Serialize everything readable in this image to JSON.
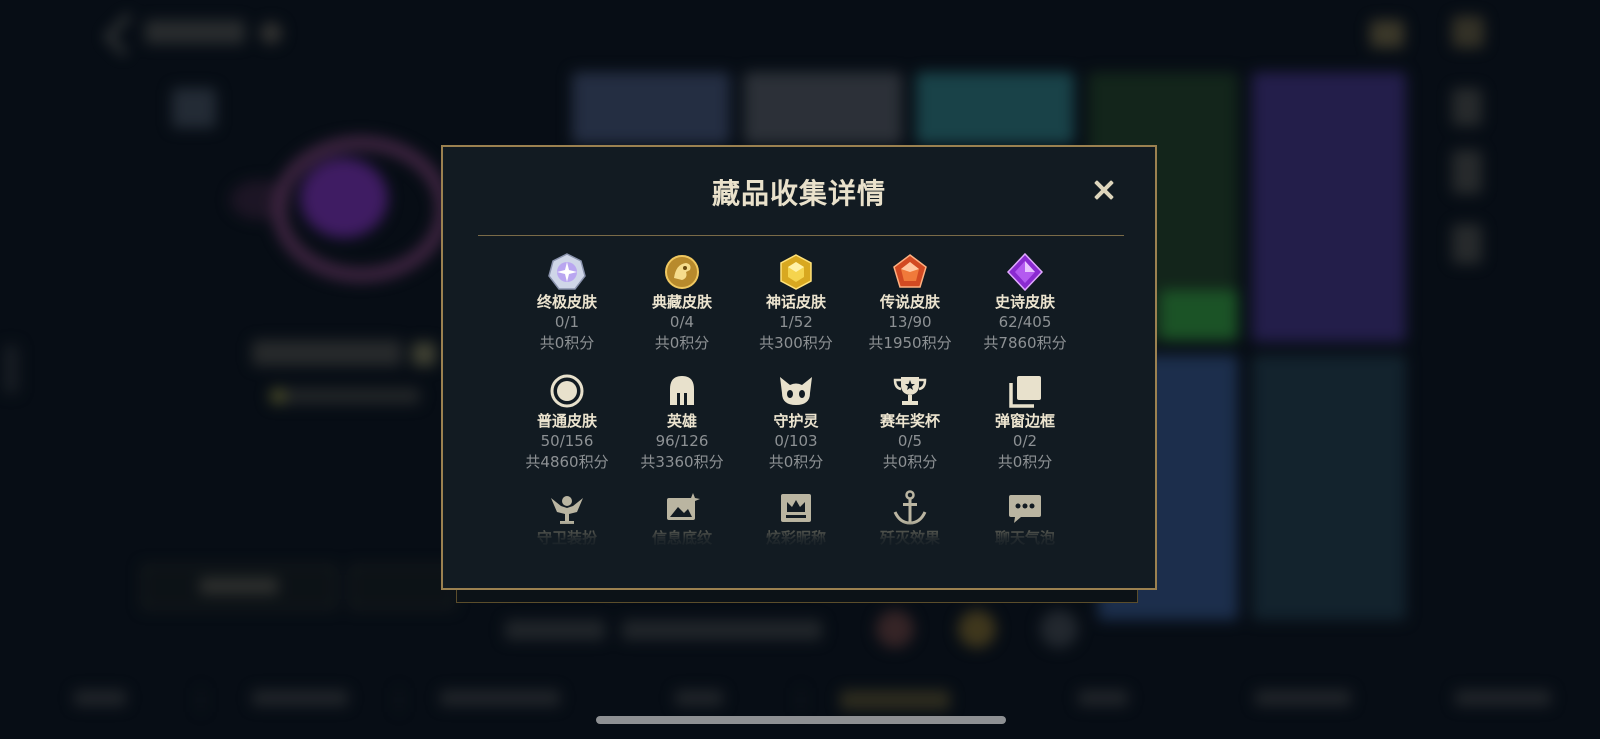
{
  "modal": {
    "title": "藏品收集详情",
    "close_label": "✕"
  },
  "rows": [
    [
      {
        "icon": "ultimate-skin-icon",
        "name": "终极皮肤",
        "count": "0/1",
        "points": "共0积分"
      },
      {
        "icon": "prestige-skin-icon",
        "name": "典藏皮肤",
        "count": "0/4",
        "points": "共0积分"
      },
      {
        "icon": "mythic-skin-icon",
        "name": "神话皮肤",
        "count": "1/52",
        "points": "共300积分"
      },
      {
        "icon": "legendary-skin-icon",
        "name": "传说皮肤",
        "count": "13/90",
        "points": "共1950积分"
      },
      {
        "icon": "epic-skin-icon",
        "name": "史诗皮肤",
        "count": "62/405",
        "points": "共7860积分"
      }
    ],
    [
      {
        "icon": "standard-skin-icon",
        "name": "普通皮肤",
        "count": "50/156",
        "points": "共4860积分"
      },
      {
        "icon": "champion-helmet-icon",
        "name": "英雄",
        "count": "96/126",
        "points": "共3360积分"
      },
      {
        "icon": "little-legend-icon",
        "name": "守护灵",
        "count": "0/103",
        "points": "共0积分"
      },
      {
        "icon": "trophy-icon",
        "name": "赛年奖杯",
        "count": "0/5",
        "points": "共0积分"
      },
      {
        "icon": "frame-stack-icon",
        "name": "弹窗边框",
        "count": "0/2",
        "points": "共0积分"
      }
    ],
    [
      {
        "icon": "ward-icon",
        "name": "守卫装扮"
      },
      {
        "icon": "banner-image-icon",
        "name": "信息底纹"
      },
      {
        "icon": "crown-nameplate-icon",
        "name": "炫彩昵称"
      },
      {
        "icon": "anchor-icon",
        "name": "歼灭效果"
      },
      {
        "icon": "chat-bubble-icon",
        "name": "聊天气泡"
      }
    ]
  ],
  "colors": {
    "modal_bg": "#121b22",
    "modal_border": "#9b8150",
    "title_text": "#e9e1cb",
    "label_text": "#ece4cf",
    "value_text": "#8d9194"
  }
}
